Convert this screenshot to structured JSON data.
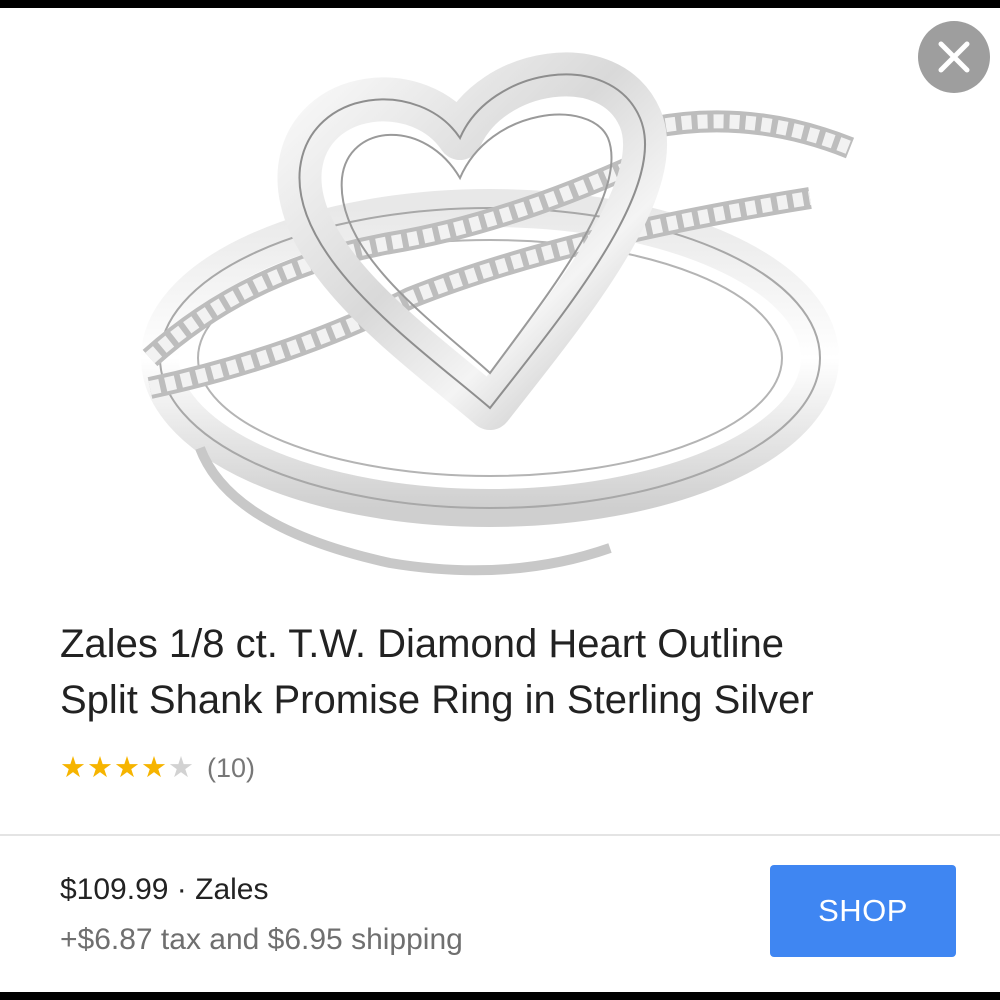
{
  "close": {
    "icon": "close-icon"
  },
  "product": {
    "image_icon": "diamond-heart-ring",
    "title_line1": "Zales 1/8 ct. T.W. Diamond Heart Outline",
    "title_line2": "Split Shank Promise Ring in Sterling Silver",
    "rating": {
      "value": 4,
      "max": 5,
      "count_label": "(10)"
    }
  },
  "offer": {
    "price": "$109.99",
    "separator": " · ",
    "seller": "Zales",
    "tax_shipping": "+$6.87 tax and $6.95 shipping"
  },
  "shop_button": {
    "label": "SHOP"
  },
  "colors": {
    "button": "#3f86f2",
    "star": "#f6b400",
    "star_empty": "#d2d2d2",
    "close_bg": "#9e9e9e"
  }
}
